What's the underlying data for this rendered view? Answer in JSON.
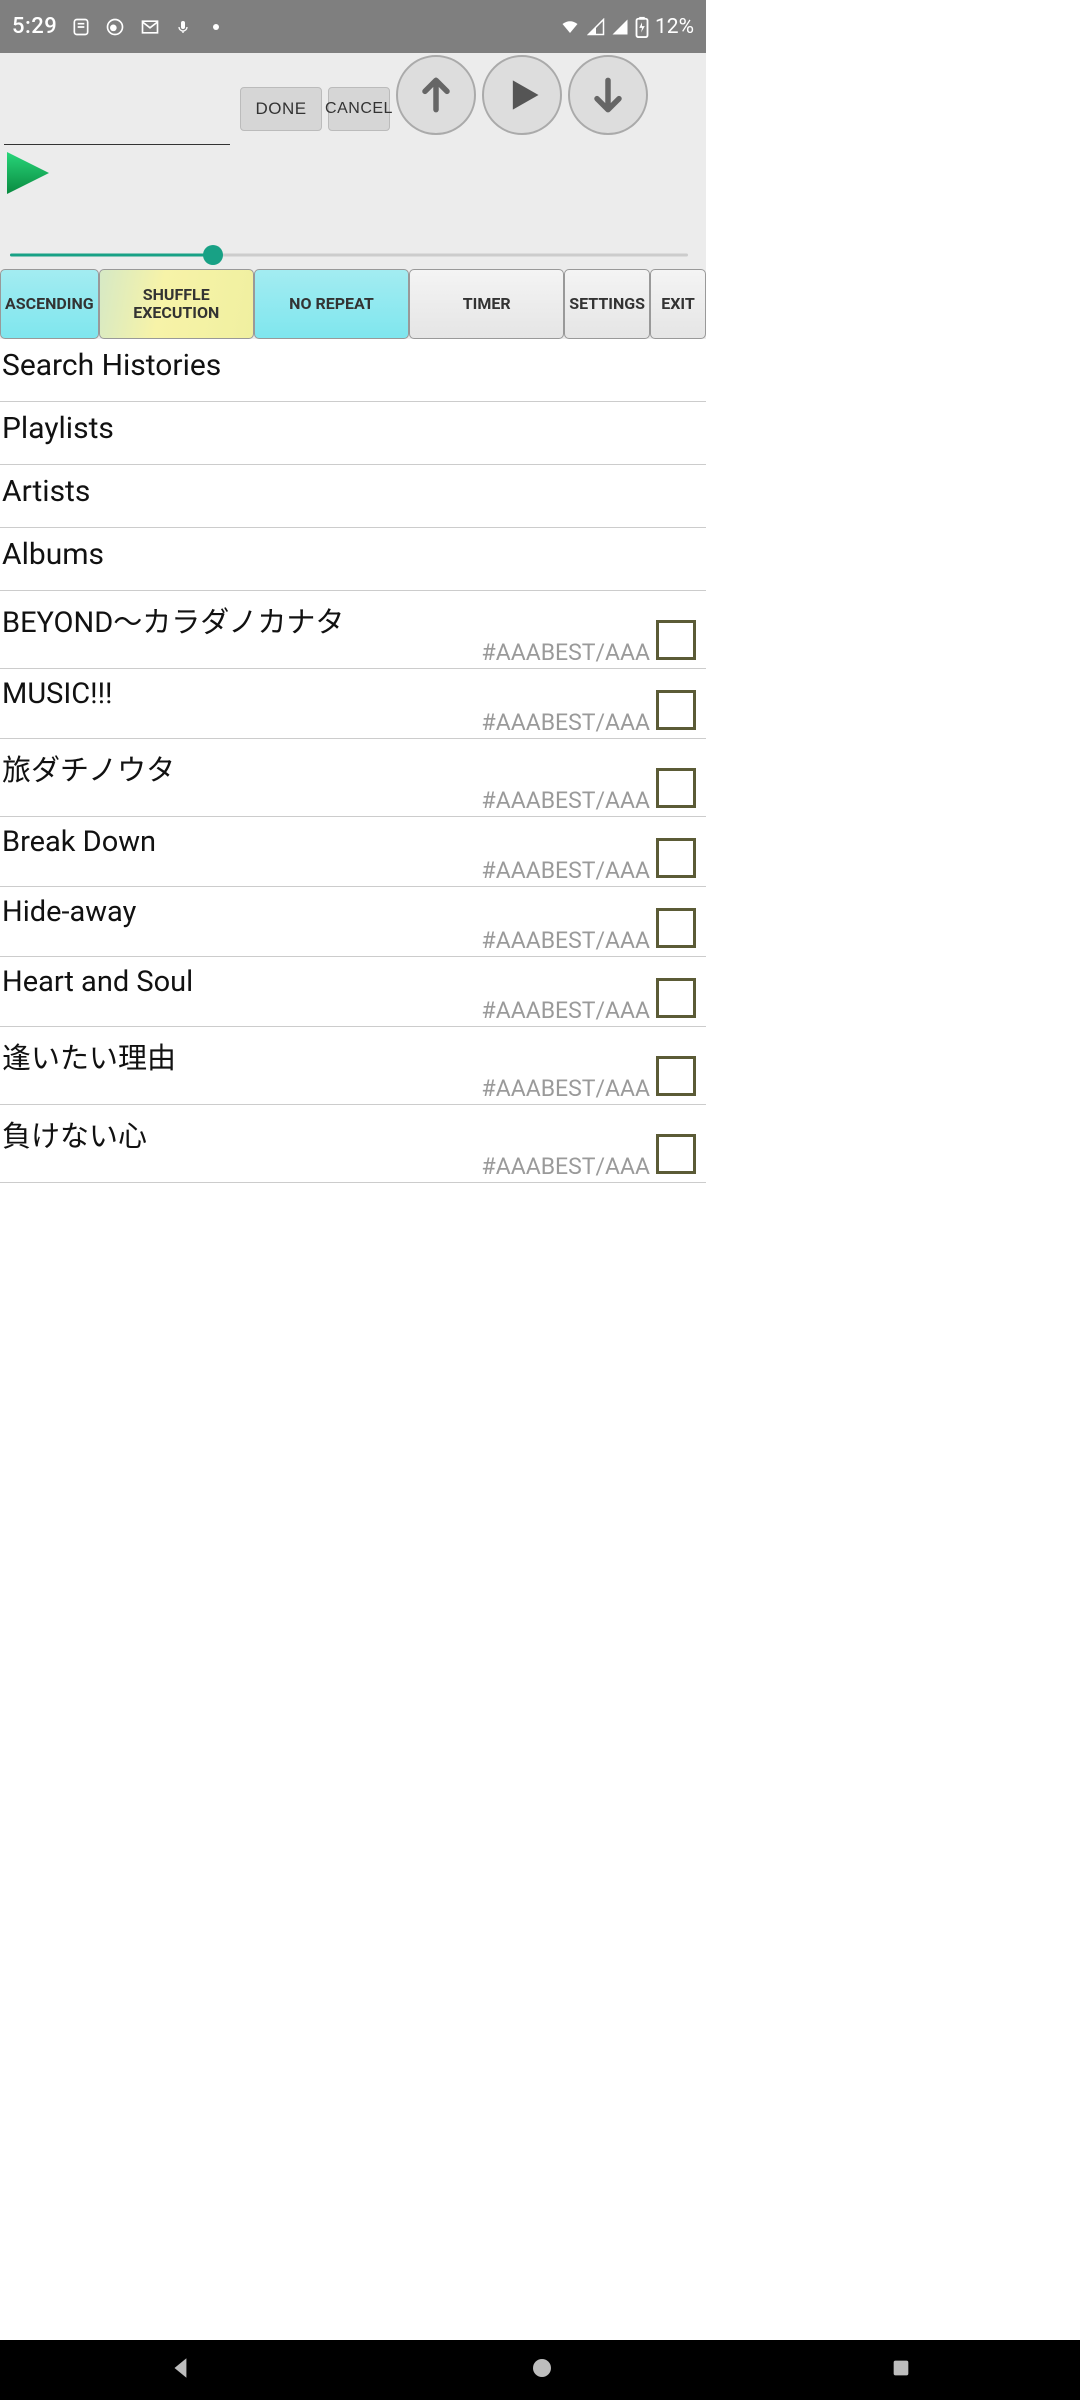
{
  "status": {
    "time": "5:29",
    "battery_text": "12%"
  },
  "top": {
    "search_value": "",
    "done_label": "DONE",
    "cancel_label": "CANCEL"
  },
  "slider": {
    "percent": 30
  },
  "modes": {
    "ascending": "ASCENDING",
    "shuffle": "SHUFFLE EXECUTION",
    "no_repeat": "NO REPEAT",
    "timer": "TIMER",
    "settings": "SETTINGS",
    "exit": "EXIT"
  },
  "sections": [
    "Search Histories",
    "Playlists",
    "Artists",
    "Albums"
  ],
  "tracks": [
    {
      "title": "BEYOND～カラダノカナタ",
      "meta": "#AAABEST/AAA",
      "checked": false
    },
    {
      "title": "MUSIC!!!",
      "meta": "#AAABEST/AAA",
      "checked": false
    },
    {
      "title": "旅ダチノウタ",
      "meta": "#AAABEST/AAA",
      "checked": false
    },
    {
      "title": "Break Down",
      "meta": "#AAABEST/AAA",
      "checked": false
    },
    {
      "title": "Hide-away",
      "meta": "#AAABEST/AAA",
      "checked": false
    },
    {
      "title": "Heart and Soul",
      "meta": "#AAABEST/AAA",
      "checked": false
    },
    {
      "title": "逢いたい理由",
      "meta": "#AAABEST/AAA",
      "checked": false
    },
    {
      "title": "負けない心",
      "meta": "#AAABEST/AAA",
      "checked": false
    }
  ]
}
